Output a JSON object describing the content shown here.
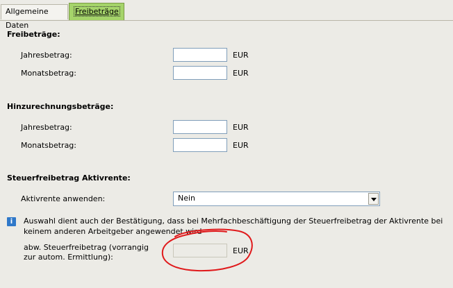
{
  "tabs": [
    {
      "label": "Allgemeine Daten"
    },
    {
      "label": "Freibeträge",
      "active": true
    }
  ],
  "sections": {
    "freibetraege": {
      "title": "Freibeträge:",
      "jahresbetrag_label": "Jahresbetrag:",
      "jahresbetrag_value": "",
      "monatsbetrag_label": "Monatsbetrag:",
      "monatsbetrag_value": ""
    },
    "hinzurechnung": {
      "title": "Hinzurechnungsbeträge:",
      "jahresbetrag_label": "Jahresbetrag:",
      "jahresbetrag_value": "",
      "monatsbetrag_label": "Monatsbetrag:",
      "monatsbetrag_value": ""
    },
    "aktivrente": {
      "title": "Steuerfreibetrag Aktivrente:",
      "anwenden_label": "Aktivrente anwenden:",
      "anwenden_selected": "Nein",
      "info_text": "Auswahl dient auch der Bestätigung, dass bei Mehrfachbeschäftigung der Steuerfreibetrag der Aktivrente bei keinem anderen Arbeitgeber angewendet wird",
      "abw_label": "abw. Steuerfreibetrag (vorrangig zur autom. Ermittlung):",
      "abw_value": ""
    }
  },
  "unit": "EUR",
  "icons": {
    "info": "info-icon",
    "dropdown": "chevron-down-icon"
  },
  "colors": {
    "active_tab": "#a5d46a",
    "background": "#ecebe6",
    "annotation": "#e0191b",
    "info_icon": "#2f78c9"
  }
}
